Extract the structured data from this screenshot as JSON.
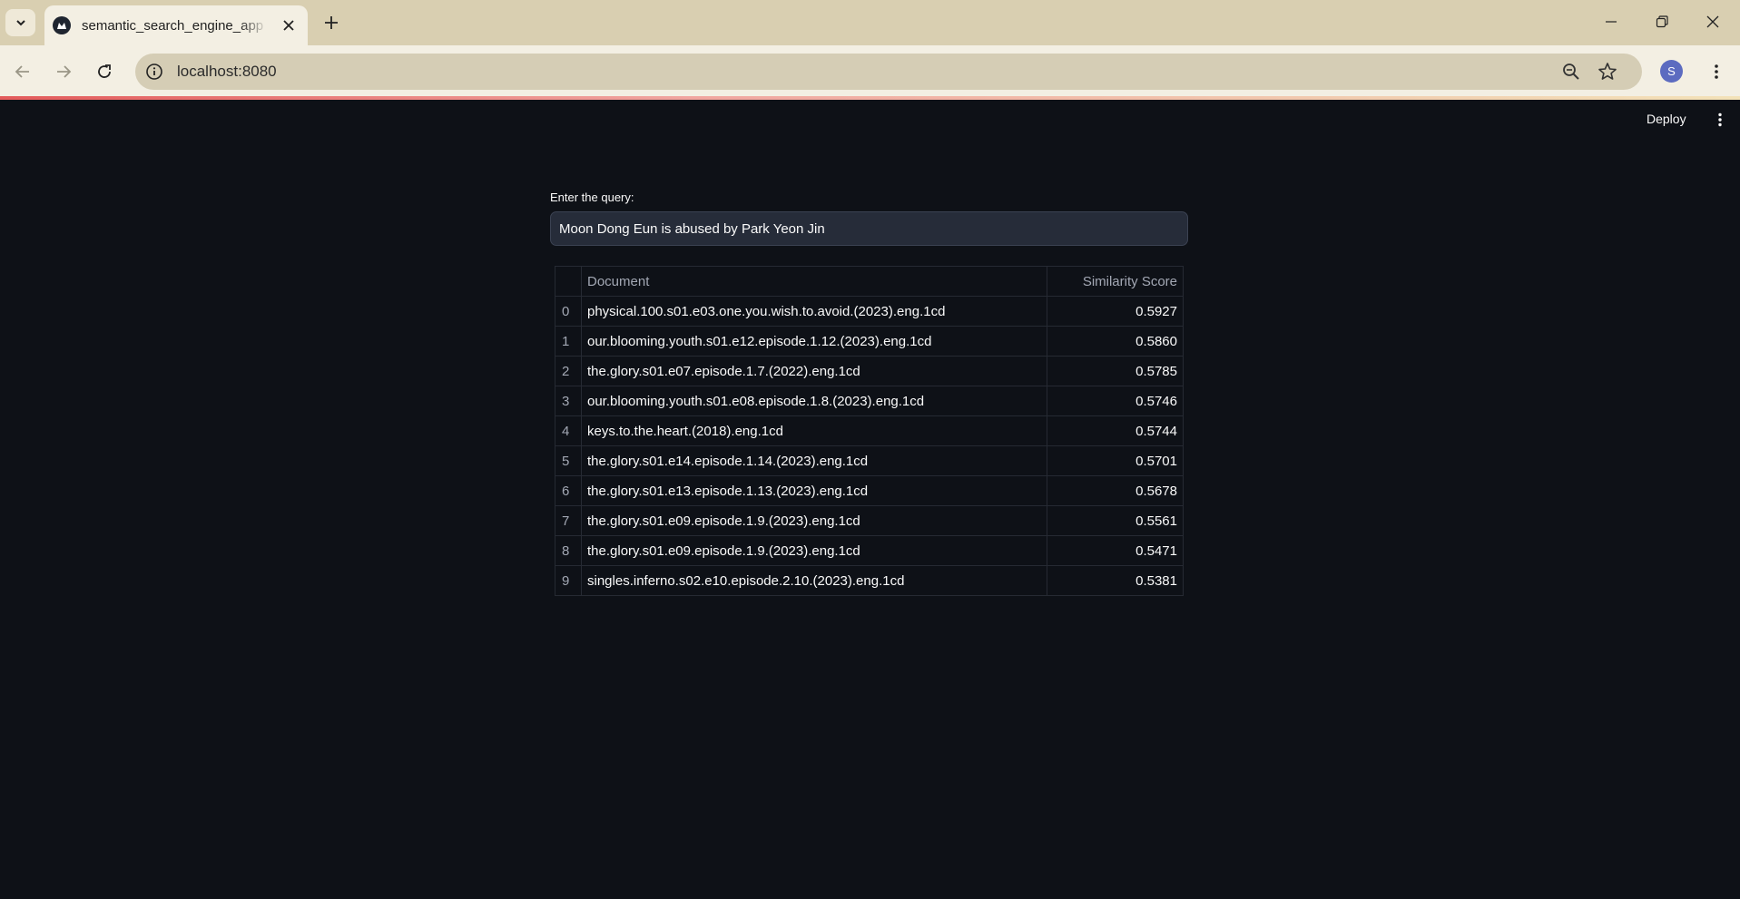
{
  "browser": {
    "tab_title": "semantic_search_engine_app · Streamlit",
    "url": "localhost:8080",
    "profile_initial": "S"
  },
  "app": {
    "deploy_label": "Deploy",
    "query_label": "Enter the query:",
    "query_value": "Moon Dong Eun is abused by Park Yeon Jin"
  },
  "table": {
    "columns": [
      "",
      "Document",
      "Similarity Score"
    ],
    "rows": [
      {
        "index": "0",
        "document": "physical.100.s01.e03.one.you.wish.to.avoid.(2023).eng.1cd",
        "score": "0.5927"
      },
      {
        "index": "1",
        "document": "our.blooming.youth.s01.e12.episode.1.12.(2023).eng.1cd",
        "score": "0.5860"
      },
      {
        "index": "2",
        "document": "the.glory.s01.e07.episode.1.7.(2022).eng.1cd",
        "score": "0.5785"
      },
      {
        "index": "3",
        "document": "our.blooming.youth.s01.e08.episode.1.8.(2023).eng.1cd",
        "score": "0.5746"
      },
      {
        "index": "4",
        "document": "keys.to.the.heart.(2018).eng.1cd",
        "score": "0.5744"
      },
      {
        "index": "5",
        "document": "the.glory.s01.e14.episode.1.14.(2023).eng.1cd",
        "score": "0.5701"
      },
      {
        "index": "6",
        "document": "the.glory.s01.e13.episode.1.13.(2023).eng.1cd",
        "score": "0.5678"
      },
      {
        "index": "7",
        "document": "the.glory.s01.e09.episode.1.9.(2023).eng.1cd",
        "score": "0.5561"
      },
      {
        "index": "8",
        "document": "the.glory.s01.e09.episode.1.9.(2023).eng.1cd",
        "score": "0.5471"
      },
      {
        "index": "9",
        "document": "singles.inferno.s02.e10.episode.2.10.(2023).eng.1cd",
        "score": "0.5381"
      }
    ]
  }
}
